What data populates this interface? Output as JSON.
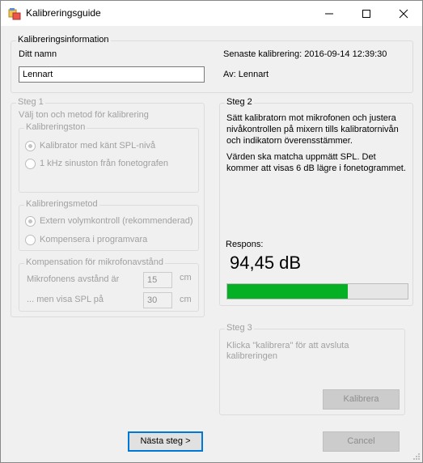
{
  "window": {
    "title": "Kalibreringsguide",
    "icon": "app-window-icon"
  },
  "info": {
    "legend": "Kalibreringsinformation",
    "name_label": "Ditt namn",
    "name_value": "Lennart",
    "last_calibration": "Senaste kalibrering: 2016-09-14 12:39:30",
    "by": "Av: Lennart"
  },
  "step1": {
    "legend": "Steg 1",
    "subtitle": "Välj ton och metod för kalibrering",
    "tone": {
      "legend": "Kalibreringston",
      "options": [
        "Kalibrator med känt SPL-nivå",
        "1 kHz sinuston från fonetografen"
      ],
      "selected": 0
    },
    "method": {
      "legend": "Kalibreringsmetod",
      "options": [
        "Extern volymkontroll (rekommenderad)",
        "Kompensera i programvara"
      ],
      "selected": 0
    },
    "compensation": {
      "legend": "Kompensation för mikrofonavstånd",
      "distance_label": "Mikrofonens avstånd är",
      "distance_value": "15",
      "spl_label": "... men visa SPL på",
      "spl_value": "30",
      "unit": "cm"
    }
  },
  "step2": {
    "legend": "Steg 2",
    "instructions_1": "Sätt kalibratorn mot mikrofonen och justera nivåkontrollen på mixern tills kalibratornivån och indikatorn överensstämmer.",
    "instructions_2": "Värden ska matcha uppmätt SPL. Det kommer att visas  6 dB lägre i fonetogrammet.",
    "response_label": "Respons:",
    "response_value": "94,45 dB",
    "meter_fraction": 0.67,
    "meter_color": "#06b025"
  },
  "step3": {
    "legend": "Steg 3",
    "instructions": "Klicka \"kalibrera\" för att avsluta kalibreringen",
    "calibrate_button": "Kalibrera"
  },
  "footer": {
    "next_button": "Nästa steg >",
    "cancel_button": "Cancel"
  }
}
